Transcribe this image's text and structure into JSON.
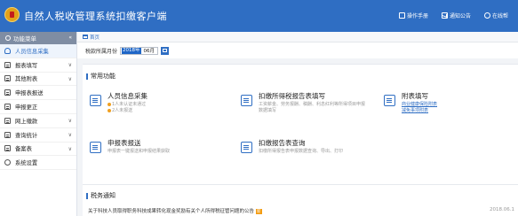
{
  "header": {
    "title": "自然人税收管理系统扣缴客户端",
    "links": [
      {
        "label": "操作手册",
        "icon": "manual-icon"
      },
      {
        "label": "通知公告",
        "icon": "mail-icon"
      },
      {
        "label": "在线帮",
        "icon": "help-icon"
      }
    ]
  },
  "sidebar": {
    "heading": "功能菜单",
    "collapse_symbol": "«",
    "items": [
      {
        "label": "人员信息采集",
        "active": true,
        "icon": "person-icon"
      },
      {
        "label": "报表填写",
        "icon": "form-icon",
        "chevron": "∨"
      },
      {
        "label": "其他附表",
        "icon": "attachment-icon",
        "chevron": "∨"
      },
      {
        "label": "申报表报送",
        "icon": "submit-icon"
      },
      {
        "label": "申报更正",
        "icon": "correct-icon"
      },
      {
        "label": "网上缴款",
        "icon": "payment-icon",
        "chevron": "∨"
      },
      {
        "label": "查询统计",
        "icon": "query-icon",
        "chevron": "∨"
      },
      {
        "label": "备案表",
        "icon": "record-icon",
        "chevron": "∨"
      },
      {
        "label": "系统设置",
        "icon": "gear-icon"
      }
    ]
  },
  "breadcrumb": {
    "home_label": "首页"
  },
  "period": {
    "label": "税款所属月份",
    "year": "2018年",
    "month": "06月"
  },
  "common_functions": {
    "title": "常用功能",
    "items": [
      {
        "title": "人员信息采集",
        "lines": [
          "1人未认证未通过",
          "2人未报送"
        ],
        "icon": "person-info-icon"
      },
      {
        "title": "扣缴所得税报告表填写",
        "lines": [
          "工资薪金、劳务报酬、稿酬、利息红利等所得项目申报",
          "数据填写"
        ],
        "icon": "tax-report-fill-icon"
      },
      {
        "title": "附表填写",
        "links": [
          "商业健康保险附表",
          "减免事项附表"
        ],
        "icon": "attachment-fill-icon"
      },
      {
        "title": "申报表报送",
        "lines": [
          "申报表一键报送和申报结果获取"
        ],
        "icon": "report-submit-icon"
      },
      {
        "title": "扣缴报告表查询",
        "lines": [
          "扣缴所得报告表申报数据查询、导出、打印"
        ],
        "icon": "report-query-icon"
      }
    ]
  },
  "notices": {
    "title": "税务通知",
    "items": [
      {
        "text": "关于科技人员取得职务科技成果转化现金奖励有关个人所得税征管问题的公告",
        "badge": "新",
        "date": "2018.06.1"
      }
    ]
  },
  "colors": {
    "header_bg": "#2f6ec3",
    "sidebar_heading_bg": "#7f8da3",
    "accent": "#2f6ec3",
    "badge": "#f39c12"
  }
}
